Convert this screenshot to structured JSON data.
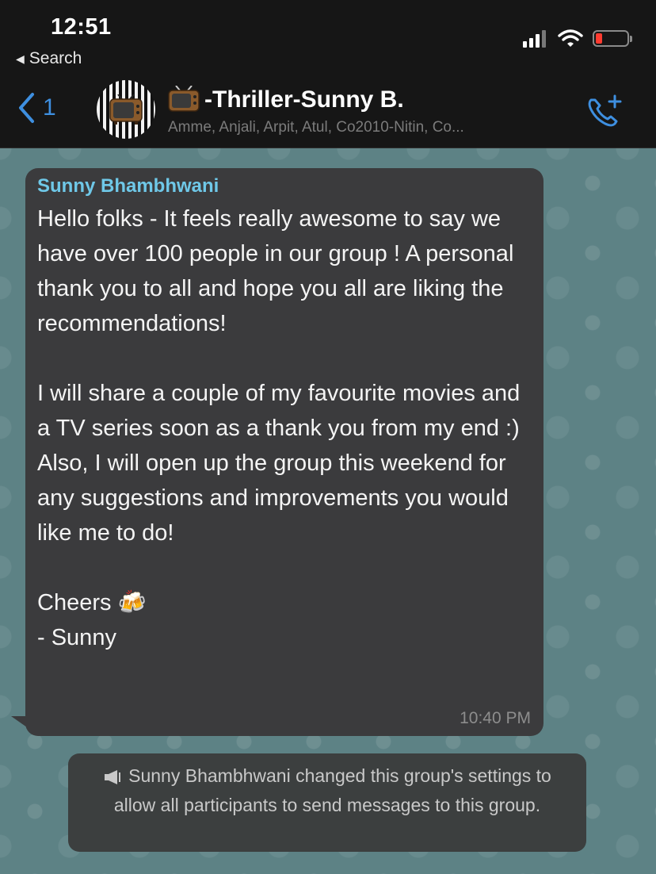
{
  "status_bar": {
    "time": "12:51",
    "back_app_label": "Search",
    "battery_color": "#ff3b30"
  },
  "header": {
    "back_count": "1",
    "group_name": "-Thriller-Sunny B.",
    "participants": "Amme, Anjali, Arpit, Atul, Co2010-Nitin, Co...",
    "title_icon": "television-icon",
    "action_icon": "add-call-icon",
    "accent_color": "#3e8fe0"
  },
  "message": {
    "sender": "Sunny Bhambhwani",
    "text": "Hello folks - It feels really awesome to say we have over 100 people in our group ! A personal thank you to all and hope you all are liking the recommendations!\n\nI will share a couple of my favourite movies and a TV series soon as a thank you from my end :)\nAlso, I will open up the group this weekend for any suggestions and improvements you would like me to do!\n\nCheers 🍻\n- Sunny",
    "time": "10:40 PM",
    "sender_color": "#6fc8e8"
  },
  "system_notice": {
    "icon": "megaphone-icon",
    "text": "Sunny Bhambhwani changed this group's settings to allow all participants to send messages to this group."
  }
}
